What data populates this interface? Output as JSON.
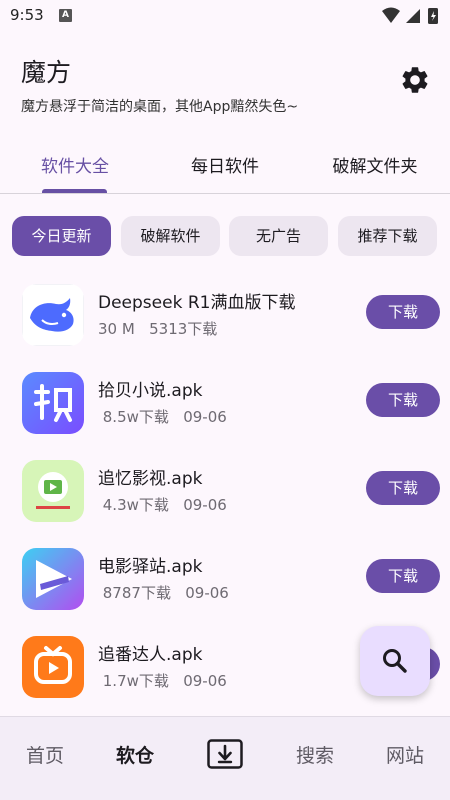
{
  "status_bar": {
    "time": "9:53",
    "badge": "A"
  },
  "header": {
    "title": "魔方",
    "subtitle": "魔方悬浮于简洁的桌面，其他App黯然失色~",
    "settings_icon": "gear-icon"
  },
  "tabs": [
    {
      "label": "软件大全",
      "active": true
    },
    {
      "label": "每日软件",
      "active": false
    },
    {
      "label": "破解文件夹",
      "active": false
    }
  ],
  "chips": [
    {
      "label": "今日更新",
      "active": true
    },
    {
      "label": "破解软件",
      "active": false
    },
    {
      "label": "无广告",
      "active": false
    },
    {
      "label": "推荐下载",
      "active": false
    }
  ],
  "apps": [
    {
      "name": "Deepseek R1满血版下载",
      "meta": "30 M   5313下载",
      "button": "下载"
    },
    {
      "name": "拾贝小说.apk",
      "meta": " 8.5w下载   09-06",
      "button": "下载"
    },
    {
      "name": "追忆影视.apk",
      "meta": " 4.3w下载   09-06",
      "button": "下载"
    },
    {
      "name": "电影驿站.apk",
      "meta": " 8787下载   09-06",
      "button": "下载"
    },
    {
      "name": "追番达人.apk",
      "meta": " 1.7w下载   09-06",
      "button": "下载"
    }
  ],
  "bottom_nav": [
    {
      "label": "首页",
      "active": false
    },
    {
      "label": "软仓",
      "active": true
    },
    {
      "label": "",
      "icon": "download-box-icon"
    },
    {
      "label": "搜索",
      "active": false
    },
    {
      "label": "网站",
      "active": false
    }
  ],
  "colors": {
    "accent": "#6a4ea8",
    "background": "#fdf7fd",
    "fab": "#e9ddff"
  }
}
